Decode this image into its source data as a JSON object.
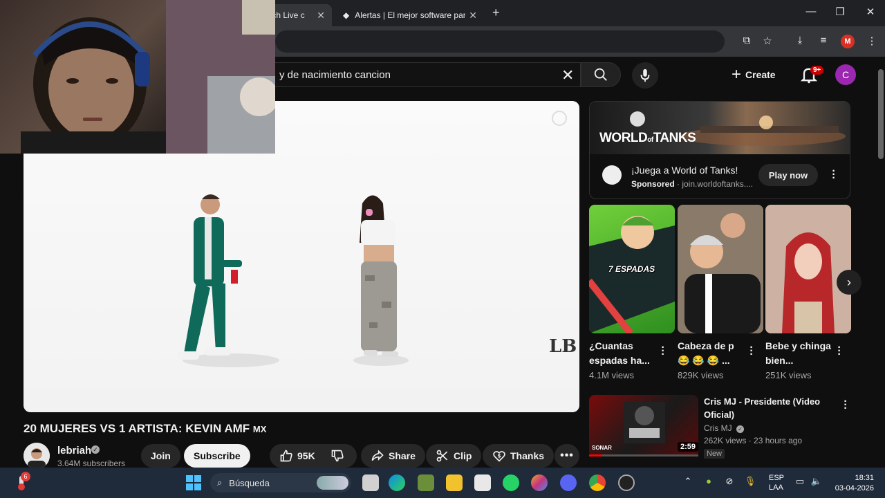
{
  "browser": {
    "tabs": [
      {
        "label": "tch Live c",
        "active": true
      },
      {
        "label": "Alertas | El mejor software para"
      }
    ],
    "profile_initial": "M"
  },
  "youtube": {
    "search_query": "y de nacimiento cancion",
    "create_label": "Create",
    "notifications_badge": "9+",
    "avatar_initial": "C"
  },
  "video": {
    "title": "20 MUJERES VS 1 ARTISTA: KEVIN AMF",
    "title_suffix": "MX",
    "watermark": "LB",
    "channel": {
      "name": "lebriah",
      "subscribers": "3.64M subscribers"
    },
    "actions": {
      "join": "Join",
      "subscribe": "Subscribe",
      "likes": "95K",
      "share": "Share",
      "clip": "Clip",
      "thanks": "Thanks"
    }
  },
  "ad": {
    "brand_logo_main": "WORLD",
    "brand_logo_of": "of",
    "brand_logo_end": "TANKS",
    "title": "¡Juega a World of Tanks!",
    "sponsored": "Sponsored",
    "domain": "join.worldoftanks....",
    "cta": "Play now"
  },
  "shorts": [
    {
      "title": "¿Cuantas espadas ha...",
      "views": "4.1M views",
      "overlay": "7 ESPADAS"
    },
    {
      "title": "Cabeza de p 😂 😂 😂 ...",
      "views": "829K views"
    },
    {
      "title": "Bebe y chinga bien...",
      "views": "251K views"
    }
  ],
  "recommended": {
    "title": "Cris MJ - Presidente (Video Oficial)",
    "channel": "Cris MJ",
    "views": "262K views",
    "age": "23 hours ago",
    "badge": "New",
    "duration": "2:59",
    "thumb_text": "SONAR",
    "watched_fraction": 0.12
  },
  "taskbar": {
    "search_placeholder": "Búsqueda",
    "weather_badge": "6",
    "lang_1": "ESP",
    "lang_2": "LAA",
    "time": "18:31",
    "date": "03-04-2026"
  }
}
